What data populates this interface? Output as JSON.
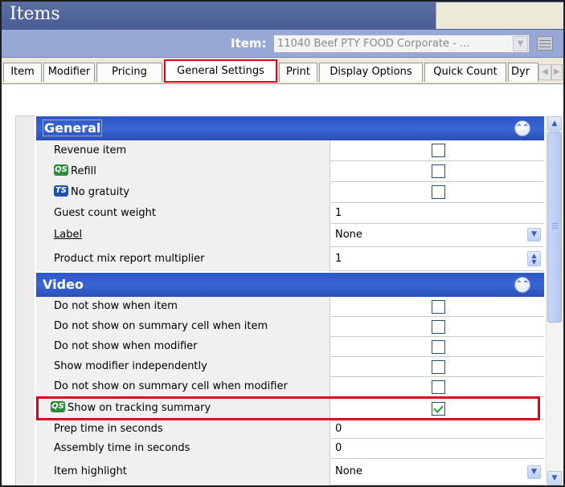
{
  "window": {
    "title": "Items"
  },
  "item_selector": {
    "label": "Item:",
    "value": "11040 Beef PTY FOOD Corporate - ...",
    "dropdown_icon": "chevron-down-icon",
    "grid_icon": "table-icon"
  },
  "tabs": [
    {
      "label": "Item",
      "active": false
    },
    {
      "label": "Modifier",
      "active": false
    },
    {
      "label": "Pricing",
      "active": false
    },
    {
      "label": "General Settings",
      "active": true
    },
    {
      "label": "Print",
      "active": false
    },
    {
      "label": "Display Options",
      "active": false
    },
    {
      "label": "Quick Count",
      "active": false
    },
    {
      "label": "Dyr",
      "active": false
    }
  ],
  "sections": {
    "general": {
      "title": "General",
      "rows": [
        {
          "label": "Revenue item",
          "type": "checkbox",
          "checked": false
        },
        {
          "label": "Refill",
          "badge": "QS",
          "type": "checkbox",
          "checked": false
        },
        {
          "label": "No gratuity",
          "badge": "TS",
          "type": "checkbox",
          "checked": false
        },
        {
          "label": "Guest count weight",
          "type": "text",
          "value": "1"
        },
        {
          "label": "Label",
          "underline": true,
          "type": "combo",
          "value": "None"
        },
        {
          "label": "Product mix report multiplier",
          "type": "spin",
          "value": "1"
        }
      ]
    },
    "video": {
      "title": "Video",
      "rows": [
        {
          "label": "Do not show when item",
          "type": "checkbox",
          "checked": false
        },
        {
          "label": "Do not show on summary cell when item",
          "type": "checkbox",
          "checked": false
        },
        {
          "label": "Do not show when modifier",
          "type": "checkbox",
          "checked": false
        },
        {
          "label": "Show modifier independently",
          "type": "checkbox",
          "checked": false
        },
        {
          "label": "Do not show on summary cell when modifier",
          "type": "checkbox",
          "checked": false
        },
        {
          "label": "Show on tracking summary",
          "badge": "QS",
          "type": "checkbox",
          "checked": true
        },
        {
          "label": "Prep time in seconds",
          "type": "text",
          "value": "0"
        },
        {
          "label": "Assembly time in seconds",
          "type": "text",
          "value": "0"
        },
        {
          "label": "Item highlight",
          "type": "combo",
          "value": "None"
        }
      ]
    }
  },
  "colors": {
    "title_bar": "#4a5d92",
    "item_bar": "#98a8d6",
    "category_header": "#2d56c4",
    "highlight": "#e0001b",
    "checkmark": "#21a121"
  }
}
